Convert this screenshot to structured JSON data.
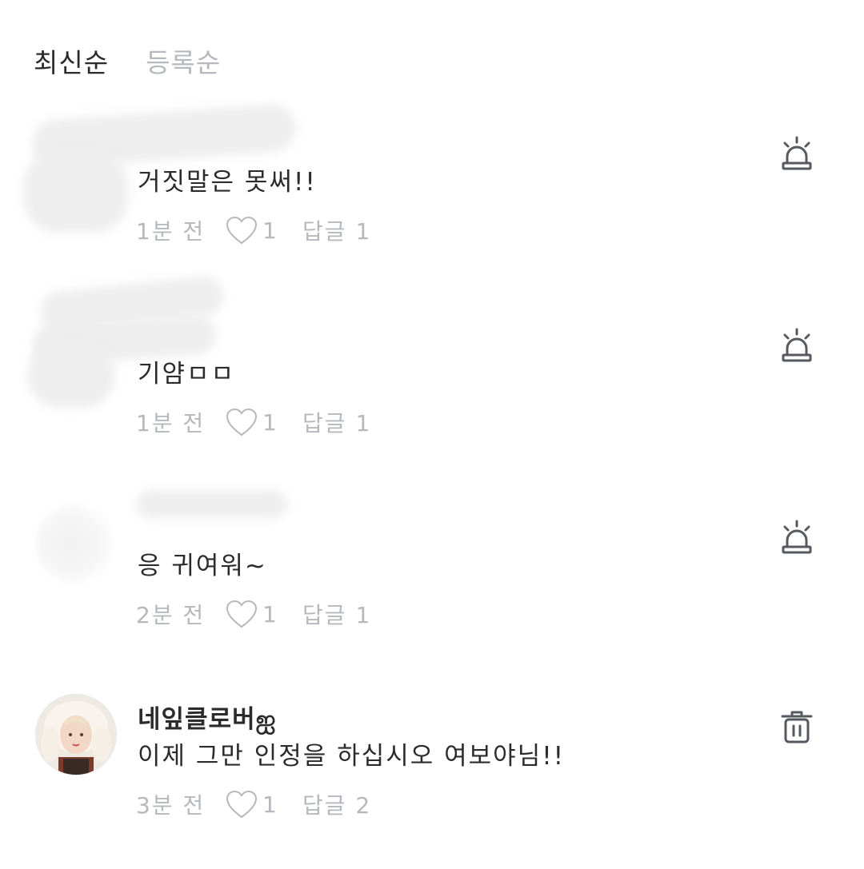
{
  "sort_tabs": [
    {
      "label": "최신순",
      "active": true
    },
    {
      "label": "등록순",
      "active": false
    }
  ],
  "comments": [
    {
      "username": "",
      "text": "거짓말은 못써!!",
      "time": "1분 전",
      "likes": "1",
      "reply_label": "답글",
      "reply_count": "1",
      "action_icon": "siren-icon"
    },
    {
      "username": "",
      "text": "기얌ㅁㅁ",
      "time": "1분 전",
      "likes": "1",
      "reply_label": "답글",
      "reply_count": "1",
      "action_icon": "siren-icon"
    },
    {
      "username": "",
      "text": "응 귀여워~",
      "time": "2분 전",
      "likes": "1",
      "reply_label": "답글",
      "reply_count": "1",
      "action_icon": "siren-icon"
    },
    {
      "username": "네잎클로버ஐ",
      "text": "이제 그만 인정을 하십시오 여보야님!!",
      "time": "3분 전",
      "likes": "1",
      "reply_label": "답글",
      "reply_count": "2",
      "action_icon": "trash-icon"
    }
  ],
  "colors": {
    "text": "#2b2b2b",
    "muted": "#b5b8bd",
    "icon": "#555a60"
  }
}
